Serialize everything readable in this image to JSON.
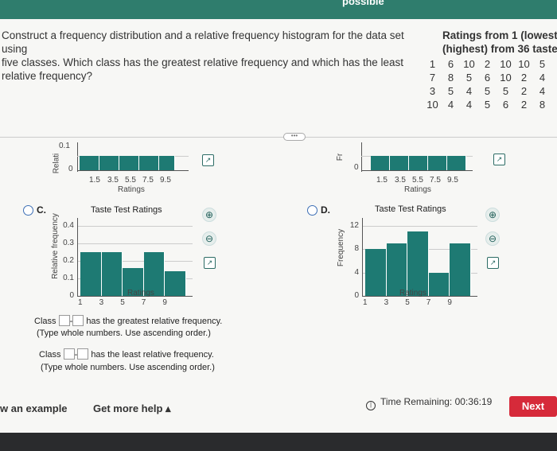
{
  "header": {
    "partial_title": "possible"
  },
  "question": {
    "line1": "Construct a frequency distribution and a relative frequency histogram for the data set using",
    "line2": "five classes. Which class has the greatest relative frequency and which has the least",
    "line3": "relative frequency?"
  },
  "ratings": {
    "title1": "Ratings from 1 (lowest)",
    "title2": "(highest) from 36 taste te",
    "rows": [
      [
        "1",
        "6",
        "10",
        "2",
        "10",
        "10",
        "5"
      ],
      [
        "7",
        "8",
        "5",
        "6",
        "10",
        "2",
        "4"
      ],
      [
        "3",
        "5",
        "4",
        "5",
        "5",
        "2",
        "4"
      ],
      [
        "10",
        "4",
        "4",
        "5",
        "6",
        "2",
        "8"
      ]
    ]
  },
  "top_charts": {
    "left": {
      "ylabel": "Relati",
      "yticks": [
        "0.1",
        "0"
      ],
      "xticks": [
        "1.5",
        "3.5",
        "5.5",
        "7.5",
        "9.5"
      ],
      "xlabel": "Ratings"
    },
    "right": {
      "ylabel": "Fr",
      "yticks": [
        "0"
      ],
      "xticks": [
        "1.5",
        "3.5",
        "5.5",
        "7.5",
        "9.5"
      ],
      "xlabel": "Ratings"
    }
  },
  "options": {
    "c": {
      "letter": "C.",
      "title": "Taste Test Ratings",
      "ylabel": "Relative frequency",
      "xlabel": "Ratings",
      "yticks": [
        "0.4",
        "0.3",
        "0.2",
        "0.1",
        "0"
      ],
      "xticks": [
        "1",
        "3",
        "5",
        "7",
        "9"
      ]
    },
    "d": {
      "letter": "D.",
      "title": "Taste Test Ratings",
      "ylabel": "Frequency",
      "xlabel": "Ratings",
      "yticks": [
        "12",
        "8",
        "4",
        "0"
      ],
      "xticks": [
        "1",
        "3",
        "5",
        "7",
        "9"
      ]
    }
  },
  "chart_data": [
    {
      "type": "bar",
      "title": "Taste Test Ratings",
      "xlabel": "Ratings",
      "ylabel": "Relative frequency",
      "categories": [
        "1-2",
        "3-4",
        "5-6",
        "7-8",
        "9-10"
      ],
      "values": [
        0.25,
        0.25,
        0.16,
        0.25,
        0.14
      ],
      "ylim": [
        0,
        0.4
      ]
    },
    {
      "type": "bar",
      "title": "Taste Test Ratings",
      "xlabel": "Ratings",
      "ylabel": "Frequency",
      "categories": [
        "1-2",
        "3-4",
        "5-6",
        "7-8",
        "9-10"
      ],
      "values": [
        8,
        9,
        11,
        4,
        9
      ],
      "ylim": [
        0,
        12
      ]
    }
  ],
  "answers": {
    "q1_prefix": "Class",
    "q1_suffix": "has the greatest relative frequency.",
    "q1_hint": "(Type whole numbers. Use ascending order.)",
    "q2_prefix": "Class",
    "q2_suffix": "has the least relative frequency.",
    "q2_hint": "(Type whole numbers. Use ascending order.)",
    "dash": "-"
  },
  "footer": {
    "example": "w an example",
    "help": "Get more help ▴",
    "time_label": "Time Remaining: 00:36:19",
    "next": "Next"
  },
  "icons": {
    "zoom_in": "zoom-in-icon",
    "zoom_out": "zoom-out-icon",
    "expand": "popout-icon"
  }
}
